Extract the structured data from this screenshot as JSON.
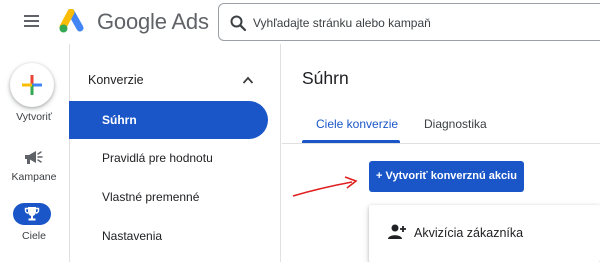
{
  "header": {
    "brand": "Google Ads",
    "search_placeholder": "Vyhľadajte stránku alebo kampaň"
  },
  "rail": {
    "create_label": "Vytvoriť",
    "campaigns_label": "Kampane",
    "goals_label": "Ciele"
  },
  "sidenav": {
    "section_title": "Konverzie",
    "items": [
      {
        "label": "Súhrn",
        "active": true
      },
      {
        "label": "Pravidlá pre hodnotu",
        "active": false
      },
      {
        "label": "Vlastné premenné",
        "active": false
      },
      {
        "label": "Nastavenia",
        "active": false
      }
    ]
  },
  "main": {
    "title": "Súhrn",
    "tabs": [
      {
        "label": "Ciele konverzie",
        "active": true
      },
      {
        "label": "Diagnostika",
        "active": false
      }
    ],
    "create_action_button": "+ Vytvoriť konverznú akciu",
    "goal_card": {
      "label": "Akvizícia zákazníka",
      "icon": "person-add-icon"
    }
  },
  "colors": {
    "accent": "#1a56c8",
    "annotation_arrow": "#e0201f"
  }
}
